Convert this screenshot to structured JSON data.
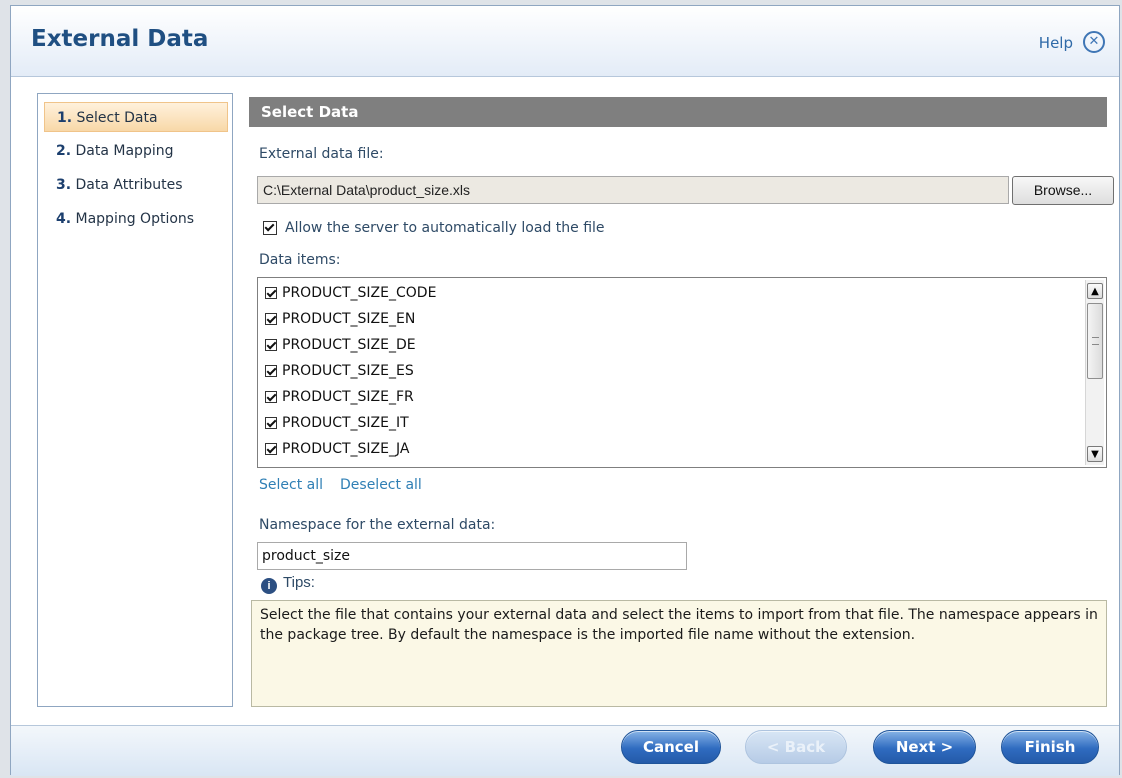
{
  "dialog": {
    "title": "External Data",
    "help_label": "Help",
    "close_glyph": "✕"
  },
  "nav": {
    "items": [
      {
        "num": "1.",
        "label": "Select Data",
        "active": true
      },
      {
        "num": "2.",
        "label": "Data Mapping",
        "active": false
      },
      {
        "num": "3.",
        "label": "Data Attributes",
        "active": false
      },
      {
        "num": "4.",
        "label": "Mapping Options",
        "active": false
      }
    ]
  },
  "select_data": {
    "header": "Select Data",
    "file_label": "External data file:",
    "file_value": "C:\\External Data\\product_size.xls",
    "browse_label": "Browse...",
    "auto_load_label": "Allow the server to automatically load the file",
    "auto_load_checked": true,
    "data_items_label": "Data items:",
    "data_items": [
      {
        "name": "PRODUCT_SIZE_CODE",
        "checked": true
      },
      {
        "name": "PRODUCT_SIZE_EN",
        "checked": true
      },
      {
        "name": "PRODUCT_SIZE_DE",
        "checked": true
      },
      {
        "name": "PRODUCT_SIZE_ES",
        "checked": true
      },
      {
        "name": "PRODUCT_SIZE_FR",
        "checked": true
      },
      {
        "name": "PRODUCT_SIZE_IT",
        "checked": true
      },
      {
        "name": "PRODUCT_SIZE_JA",
        "checked": true
      }
    ],
    "select_all_label": "Select all",
    "deselect_all_label": "Deselect all",
    "namespace_label": "Namespace for the external data:",
    "namespace_value": "product_size",
    "tips_label": "Tips:",
    "tips_text": "Select the file that contains your external data and select the items to import from that file. The namespace appears in the package tree. By default the namespace is the imported file name without the extension."
  },
  "footer": {
    "cancel_label": "Cancel",
    "back_label": "< Back",
    "next_label": "Next >",
    "finish_label": "Finish"
  }
}
